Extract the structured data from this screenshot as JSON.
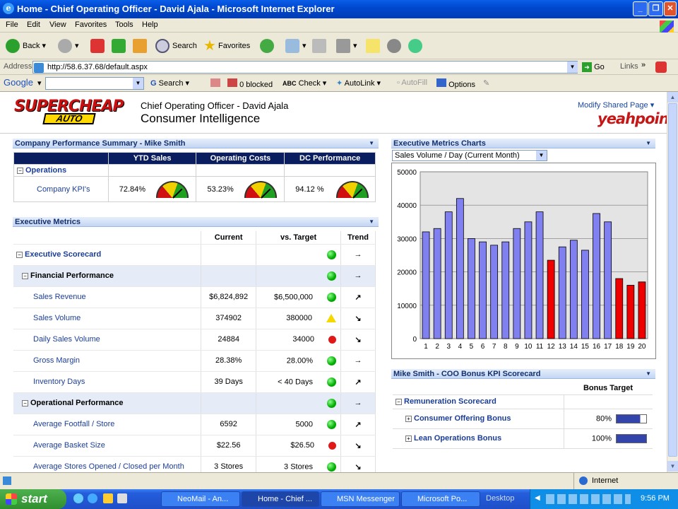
{
  "window": {
    "title": "Home - Chief Operating Officer - David Ajala - Microsoft Internet Explorer"
  },
  "menu": [
    "File",
    "Edit",
    "View",
    "Favorites",
    "Tools",
    "Help"
  ],
  "toolbar": {
    "back": "Back",
    "search": "Search",
    "favorites": "Favorites"
  },
  "address": {
    "label": "Address",
    "url": "http://58.6.37.68/default.aspx",
    "go": "Go",
    "links": "Links"
  },
  "google": {
    "label": "Google",
    "search": "Search",
    "blocked": "0 blocked",
    "check": "Check",
    "autolink": "AutoLink",
    "autofill": "AutoFill",
    "options": "Options"
  },
  "header": {
    "logo_top": "SUPERCHEAP",
    "logo_bottom": "AUTO",
    "role": "Chief Operating Officer - David Ajala",
    "title": "Consumer Intelligence",
    "modify": "Modify Shared Page",
    "brand": "yeahpoint"
  },
  "cps": {
    "title": "Company Performance Summary - Mike Smith",
    "cols": [
      "YTD Sales",
      "Operating Costs",
      "DC Performance"
    ],
    "group": "Operations",
    "row_label": "Company KPI's",
    "values": [
      "72.84%",
      "53.23%",
      "94.12 %"
    ]
  },
  "em": {
    "title": "Executive Metrics",
    "cols": [
      "Current",
      "vs. Target",
      "Trend"
    ],
    "rows": [
      {
        "label": "Executive Scorecard",
        "current": "",
        "target": "",
        "status": "green",
        "trend": "→",
        "level": 0
      },
      {
        "label": "Financial Performance",
        "current": "",
        "target": "",
        "status": "green",
        "trend": "→",
        "level": 1
      },
      {
        "label": "Sales Revenue",
        "current": "$6,824,892",
        "target": "$6,500,000",
        "status": "green",
        "trend": "↗",
        "level": 2
      },
      {
        "label": "Sales Volume",
        "current": "374902",
        "target": "380000",
        "status": "yellow",
        "trend": "↘",
        "level": 2
      },
      {
        "label": "Daily Sales Volume",
        "current": "24884",
        "target": "34000",
        "status": "red",
        "trend": "↘",
        "level": 2
      },
      {
        "label": "Gross Margin",
        "current": "28.38%",
        "target": "28.00%",
        "status": "green",
        "trend": "→",
        "level": 2
      },
      {
        "label": "Inventory Days",
        "current": "39 Days",
        "target": "< 40 Days",
        "status": "green",
        "trend": "↗",
        "level": 2
      },
      {
        "label": "Operational Performance",
        "current": "",
        "target": "",
        "status": "green",
        "trend": "→",
        "level": 1
      },
      {
        "label": "Average Footfall / Store",
        "current": "6592",
        "target": "5000",
        "status": "green",
        "trend": "↗",
        "level": 2
      },
      {
        "label": "Average Basket Size",
        "current": "$22.56",
        "target": "$26.50",
        "status": "red",
        "trend": "↘",
        "level": 2
      },
      {
        "label": "Average Stores Opened / Closed per Month",
        "current": "3 Stores",
        "target": "3 Stores",
        "status": "green",
        "trend": "↘",
        "level": 2
      }
    ]
  },
  "charts": {
    "title": "Executive Metrics Charts",
    "selector": "Sales Volume / Day (Current Month)"
  },
  "chart_data": {
    "type": "bar",
    "title": "",
    "categories": [
      "1",
      "2",
      "3",
      "4",
      "5",
      "6",
      "7",
      "8",
      "9",
      "10",
      "11",
      "12",
      "13",
      "14",
      "15",
      "16",
      "17",
      "18",
      "19",
      "20"
    ],
    "values": [
      32000,
      33000,
      38000,
      42000,
      30000,
      29000,
      28000,
      29000,
      33000,
      35000,
      38000,
      23500,
      27500,
      29500,
      26500,
      37500,
      35000,
      18000,
      16000,
      17000
    ],
    "colors": [
      "#8080f0",
      "#8080f0",
      "#8080f0",
      "#8080f0",
      "#8080f0",
      "#8080f0",
      "#8080f0",
      "#8080f0",
      "#8080f0",
      "#8080f0",
      "#8080f0",
      "#ee0000",
      "#8080f0",
      "#8080f0",
      "#8080f0",
      "#8080f0",
      "#8080f0",
      "#ee0000",
      "#ee0000",
      "#ee0000"
    ],
    "ylim": [
      0,
      50000
    ],
    "yticks": [
      0,
      10000,
      20000,
      30000,
      40000,
      50000
    ]
  },
  "bonus": {
    "title": "Mike Smith - COO Bonus KPI Scorecard",
    "col": "Bonus Target",
    "group": "Remuneration Scorecard",
    "rows": [
      {
        "label": "Consumer Offering Bonus",
        "value": "80%"
      },
      {
        "label": "Lean Operations Bonus",
        "value": "100%"
      }
    ]
  },
  "status": {
    "zone": "Internet"
  },
  "taskbar": {
    "start": "start",
    "tasks": [
      "NeoMail - An...",
      "Home - Chief ...",
      "MSN Messenger",
      "Microsoft Po...",
      "Desktop"
    ],
    "time": "9:56 PM"
  }
}
